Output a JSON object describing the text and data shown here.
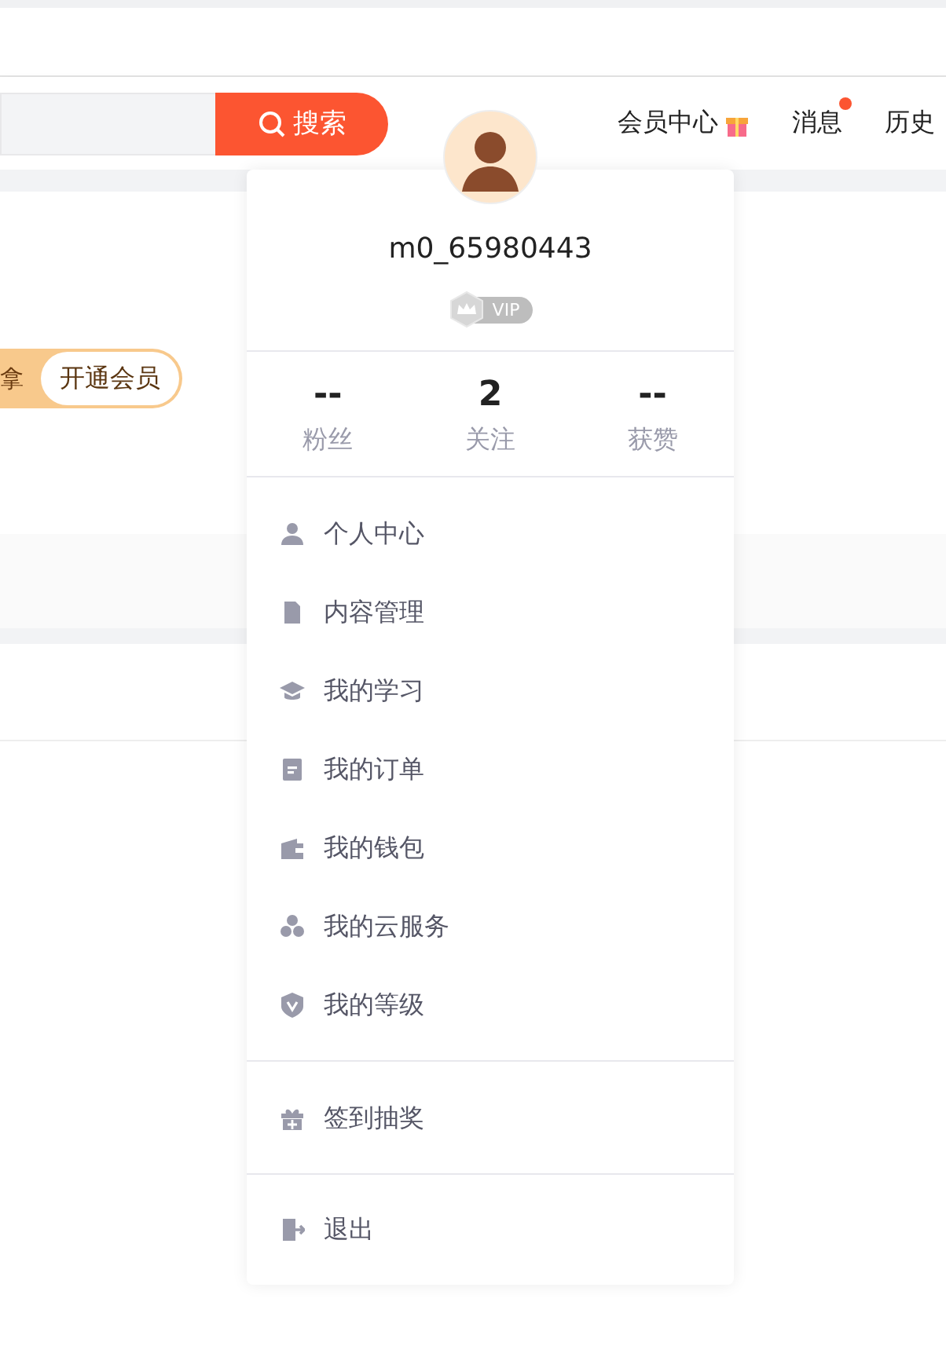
{
  "search": {
    "button": "搜索"
  },
  "nav": [
    {
      "label": "会员中心",
      "gift": true,
      "unread": false
    },
    {
      "label": "消息",
      "gift": false,
      "unread": true
    },
    {
      "label": "历史",
      "gift": false,
      "unread": false
    }
  ],
  "promo": {
    "partial_text": "拿",
    "button": "开通会员"
  },
  "user_menu": {
    "username": "m0_65980443",
    "badge": "VIP",
    "stats": [
      {
        "value": "--",
        "label": "粉丝"
      },
      {
        "value": "2",
        "label": "关注"
      },
      {
        "value": "--",
        "label": "获赞"
      }
    ],
    "groups": [
      [
        {
          "label": "个人中心",
          "kind": "person"
        },
        {
          "label": "内容管理",
          "kind": "file"
        },
        {
          "label": "我的学习",
          "kind": "cap"
        },
        {
          "label": "我的订单",
          "kind": "order"
        },
        {
          "label": "我的钱包",
          "kind": "wallet"
        },
        {
          "label": "我的云服务",
          "kind": "cloud"
        },
        {
          "label": "我的等级",
          "kind": "level"
        }
      ],
      [
        {
          "label": "签到抽奖",
          "kind": "gift"
        }
      ],
      [
        {
          "label": "退出",
          "kind": "exit"
        }
      ]
    ]
  }
}
